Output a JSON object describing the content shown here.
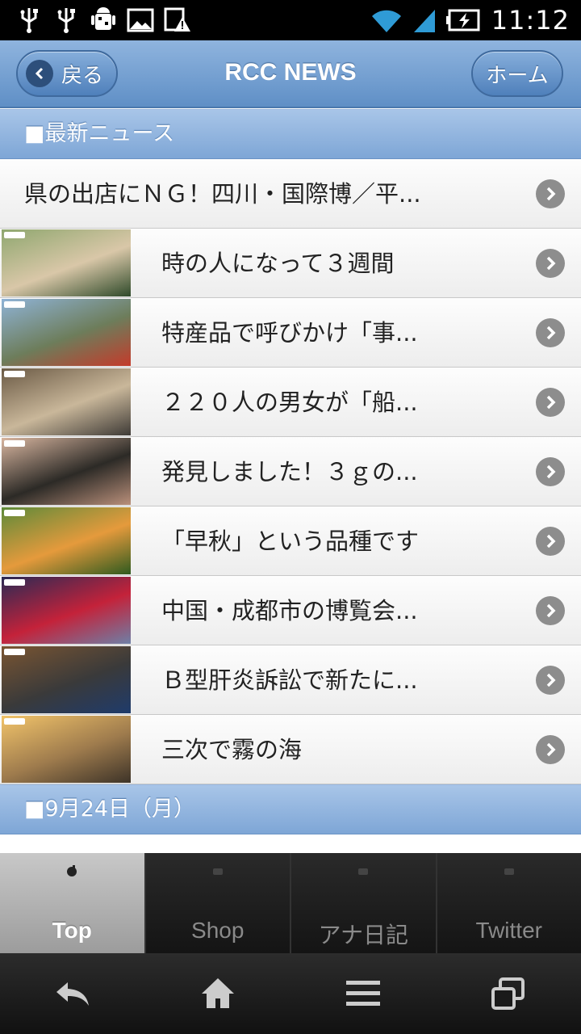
{
  "status_bar": {
    "time": "11:12",
    "left_icons": [
      "usb-icon",
      "usb-icon",
      "android-debug-icon",
      "image-icon",
      "warning-icon"
    ],
    "right_icons": [
      "wifi-icon",
      "signal-icon",
      "battery-charging-icon"
    ]
  },
  "header": {
    "back_label": "戻る",
    "title": "RCC NEWS",
    "home_label": "ホーム"
  },
  "sections": {
    "latest": "■最新ニュース",
    "date": "■9月24日（月）"
  },
  "news": [
    {
      "title": "県の出店にＮＧ！四川・国際博／平...",
      "thumb": false
    },
    {
      "title": "時の人になって３週間",
      "thumb": true,
      "thumb_colors": [
        "#8fa76f",
        "#d9c7a8",
        "#2f4a2a"
      ]
    },
    {
      "title": "特産品で呼びかけ「事...",
      "thumb": true,
      "thumb_colors": [
        "#8fb3d6",
        "#6d7d5b",
        "#c43b2b"
      ]
    },
    {
      "title": "２２０人の男女が「船...",
      "thumb": true,
      "thumb_colors": [
        "#6b5a45",
        "#c9b79a",
        "#3e3a36"
      ]
    },
    {
      "title": "発見しました！３ｇの...",
      "thumb": true,
      "thumb_colors": [
        "#d9b6a0",
        "#2c2a26",
        "#b98f7a"
      ]
    },
    {
      "title": "「早秋」という品種です",
      "thumb": true,
      "thumb_colors": [
        "#5d8a3a",
        "#e59a3c",
        "#2f5a1f"
      ]
    },
    {
      "title": "中国・成都市の博覧会...",
      "thumb": true,
      "thumb_colors": [
        "#2a2a55",
        "#c4223a",
        "#6e7fa6"
      ]
    },
    {
      "title": "Ｂ型肝炎訴訟で新たに...",
      "thumb": true,
      "thumb_colors": [
        "#7a5532",
        "#3a3a3a",
        "#1f3b6b"
      ]
    },
    {
      "title": "三次で霧の海",
      "thumb": true,
      "thumb_colors": [
        "#f2c46a",
        "#9e7b4d",
        "#3d3328"
      ]
    }
  ],
  "tabs": [
    {
      "label": "Top",
      "active": true,
      "icon": "apple-icon"
    },
    {
      "label": "Shop",
      "active": false,
      "icon": "shop-icon"
    },
    {
      "label": "アナ日記",
      "active": false,
      "icon": "microphone-icon"
    },
    {
      "label": "Twitter",
      "active": false,
      "icon": "bird-icon"
    }
  ],
  "system_nav": [
    "back-icon",
    "home-icon",
    "menu-icon",
    "recent-apps-icon"
  ]
}
